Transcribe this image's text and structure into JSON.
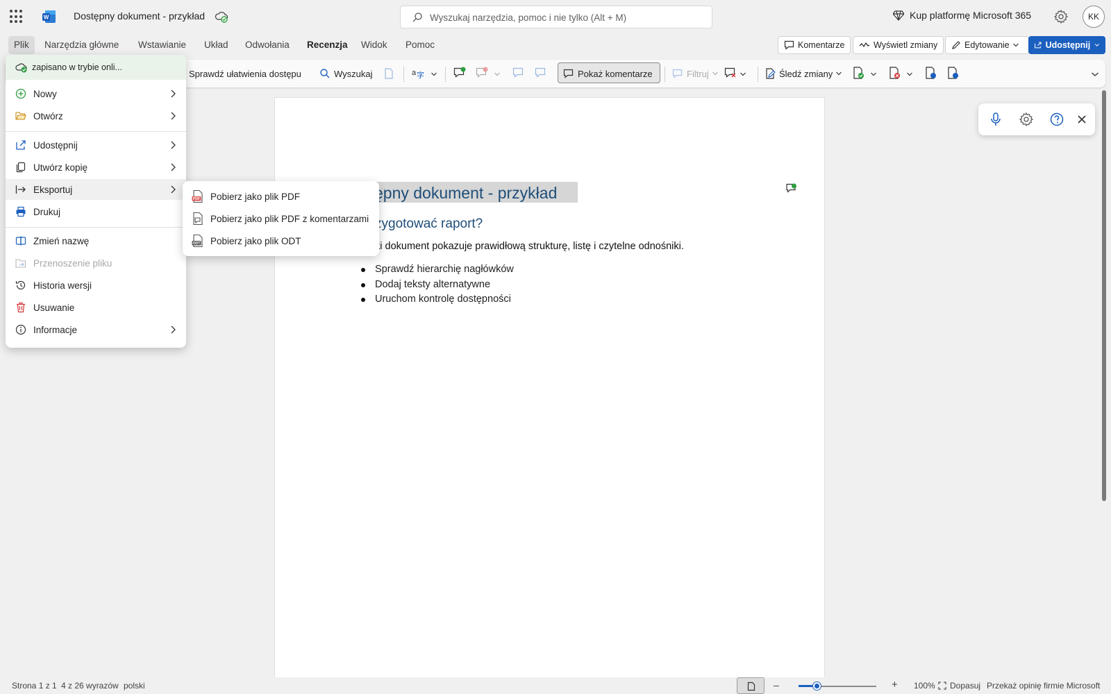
{
  "app": {
    "document_title": "Dostępny dokument - przykład",
    "search_placeholder": "Wyszukaj narzędzia, pomoc i nie tylko (Alt + M)",
    "buy_label": "Kup platformę Microsoft 365",
    "avatar_initials": "KK"
  },
  "tabs": [
    "Plik",
    "Narzędzia główne",
    "Wstawianie",
    "Układ",
    "Odwołania",
    "Recenzja",
    "Widok",
    "Pomoc"
  ],
  "header_buttons": {
    "comments": "Komentarze",
    "show_changes": "Wyświetl zmiany",
    "editing": "Edytowanie",
    "share": "Udostępnij"
  },
  "ribbon": {
    "accessibility": "Sprawdź ułatwienia dostępu",
    "search": "Wyszukaj",
    "show_comments": "Pokaż komentarze",
    "filter": "Filtruj",
    "track_changes": "Śledź zmiany"
  },
  "file_menu": {
    "saved_status": "zapisano w trybie onli...",
    "items": [
      {
        "label": "Nowy"
      },
      {
        "label": "Otwórz"
      },
      {
        "label": "Udostępnij"
      },
      {
        "label": "Utwórz kopię"
      },
      {
        "label": "Eksportuj"
      },
      {
        "label": "Drukuj"
      },
      {
        "label": "Zmień nazwę"
      },
      {
        "label": "Przenoszenie pliku"
      },
      {
        "label": "Historia wersji"
      },
      {
        "label": "Usuwanie"
      },
      {
        "label": "Informacje"
      }
    ]
  },
  "export_submenu": [
    {
      "label": "Pobierz jako plik PDF"
    },
    {
      "label": "Pobierz jako plik PDF z komentarzami"
    },
    {
      "label": "Pobierz jako plik ODT"
    }
  ],
  "document": {
    "heading1": "ępny dokument - przykład",
    "heading2": "zygotować raport?",
    "paragraph": "ki dokument pokazuje prawidłową strukturę, listę i czytelne odnośniki.",
    "list": [
      "Sprawdź hierarchię nagłówków",
      "Dodaj teksty alternatywne",
      "Uruchom kontrolę dostępności"
    ]
  },
  "status": {
    "page": "Strona 1 z 1",
    "words": "4 z 26 wyrazów",
    "language": "polski",
    "zoom": "100%",
    "fit": "Dopasuj",
    "feedback": "Przekaż opinię firmie Microsoft",
    "zoom_level_percent": 100
  },
  "colors": {
    "accent": "#1b5fbf",
    "heading": "#1f4e79",
    "saved_bg": "#eaf3ea"
  }
}
